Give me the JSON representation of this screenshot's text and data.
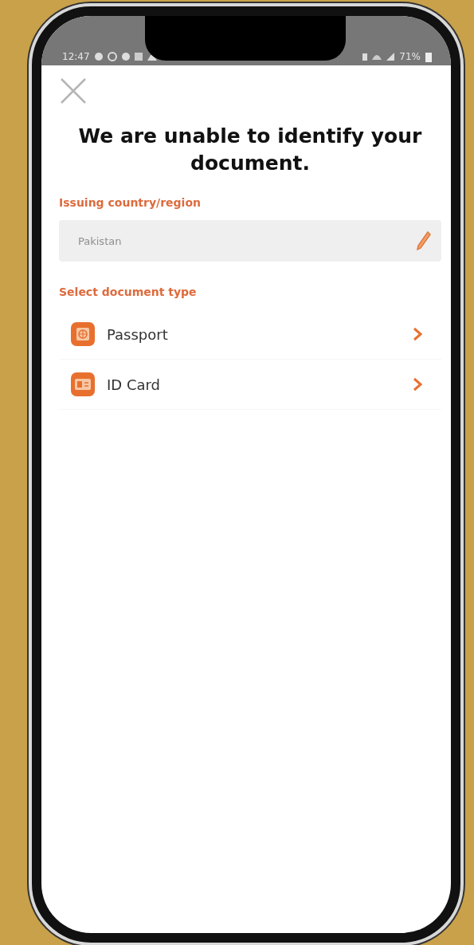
{
  "status_bar": {
    "time": "12:47",
    "battery": "71%"
  },
  "title": "We are unable to identify your document.",
  "country": {
    "label": "Issuing country/region",
    "value": "Pakistan"
  },
  "document_type": {
    "label": "Select document type",
    "options": [
      {
        "label": "Passport",
        "kind": "passport"
      },
      {
        "label": "ID Card",
        "kind": "id_card"
      }
    ]
  }
}
